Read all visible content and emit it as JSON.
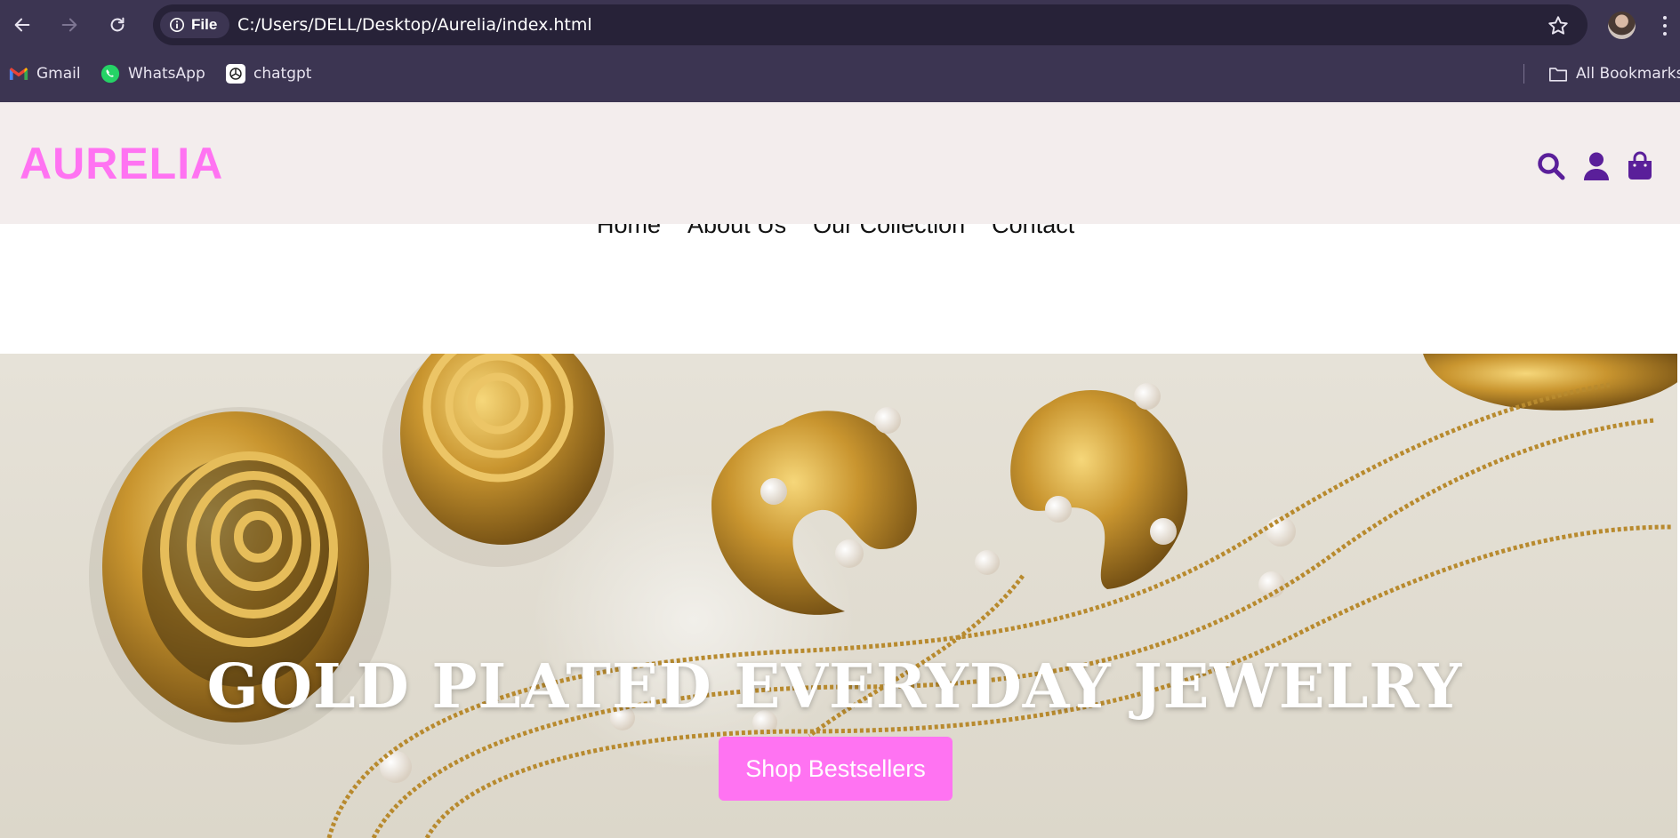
{
  "browser": {
    "site_chip_label": "File",
    "url": "C:/Users/DELL/Desktop/Aurelia/index.html",
    "bookmarks": [
      {
        "label": "Gmail",
        "icon": "gmail-icon"
      },
      {
        "label": "WhatsApp",
        "icon": "whatsapp-icon"
      },
      {
        "label": "chatgpt",
        "icon": "chatgpt-icon"
      }
    ],
    "all_bookmarks_label": "All Bookmarks"
  },
  "site": {
    "logo": "AURELIA",
    "header_icons": [
      "search-icon",
      "user-icon",
      "shopping-bag-icon"
    ],
    "nav": [
      "Home",
      "About Us",
      "Our Collection",
      "Contact"
    ]
  },
  "hero": {
    "title": "GOLD PLATED EVERYDAY JEWELRY",
    "button_label": "Shop Bestsellers"
  },
  "colors": {
    "chrome_bg": "#3c3552",
    "omnibox_bg": "#272238",
    "header_bg": "#f3eded",
    "brand_pink": "#ff73f2",
    "icon_purple": "#5a1f9a"
  }
}
